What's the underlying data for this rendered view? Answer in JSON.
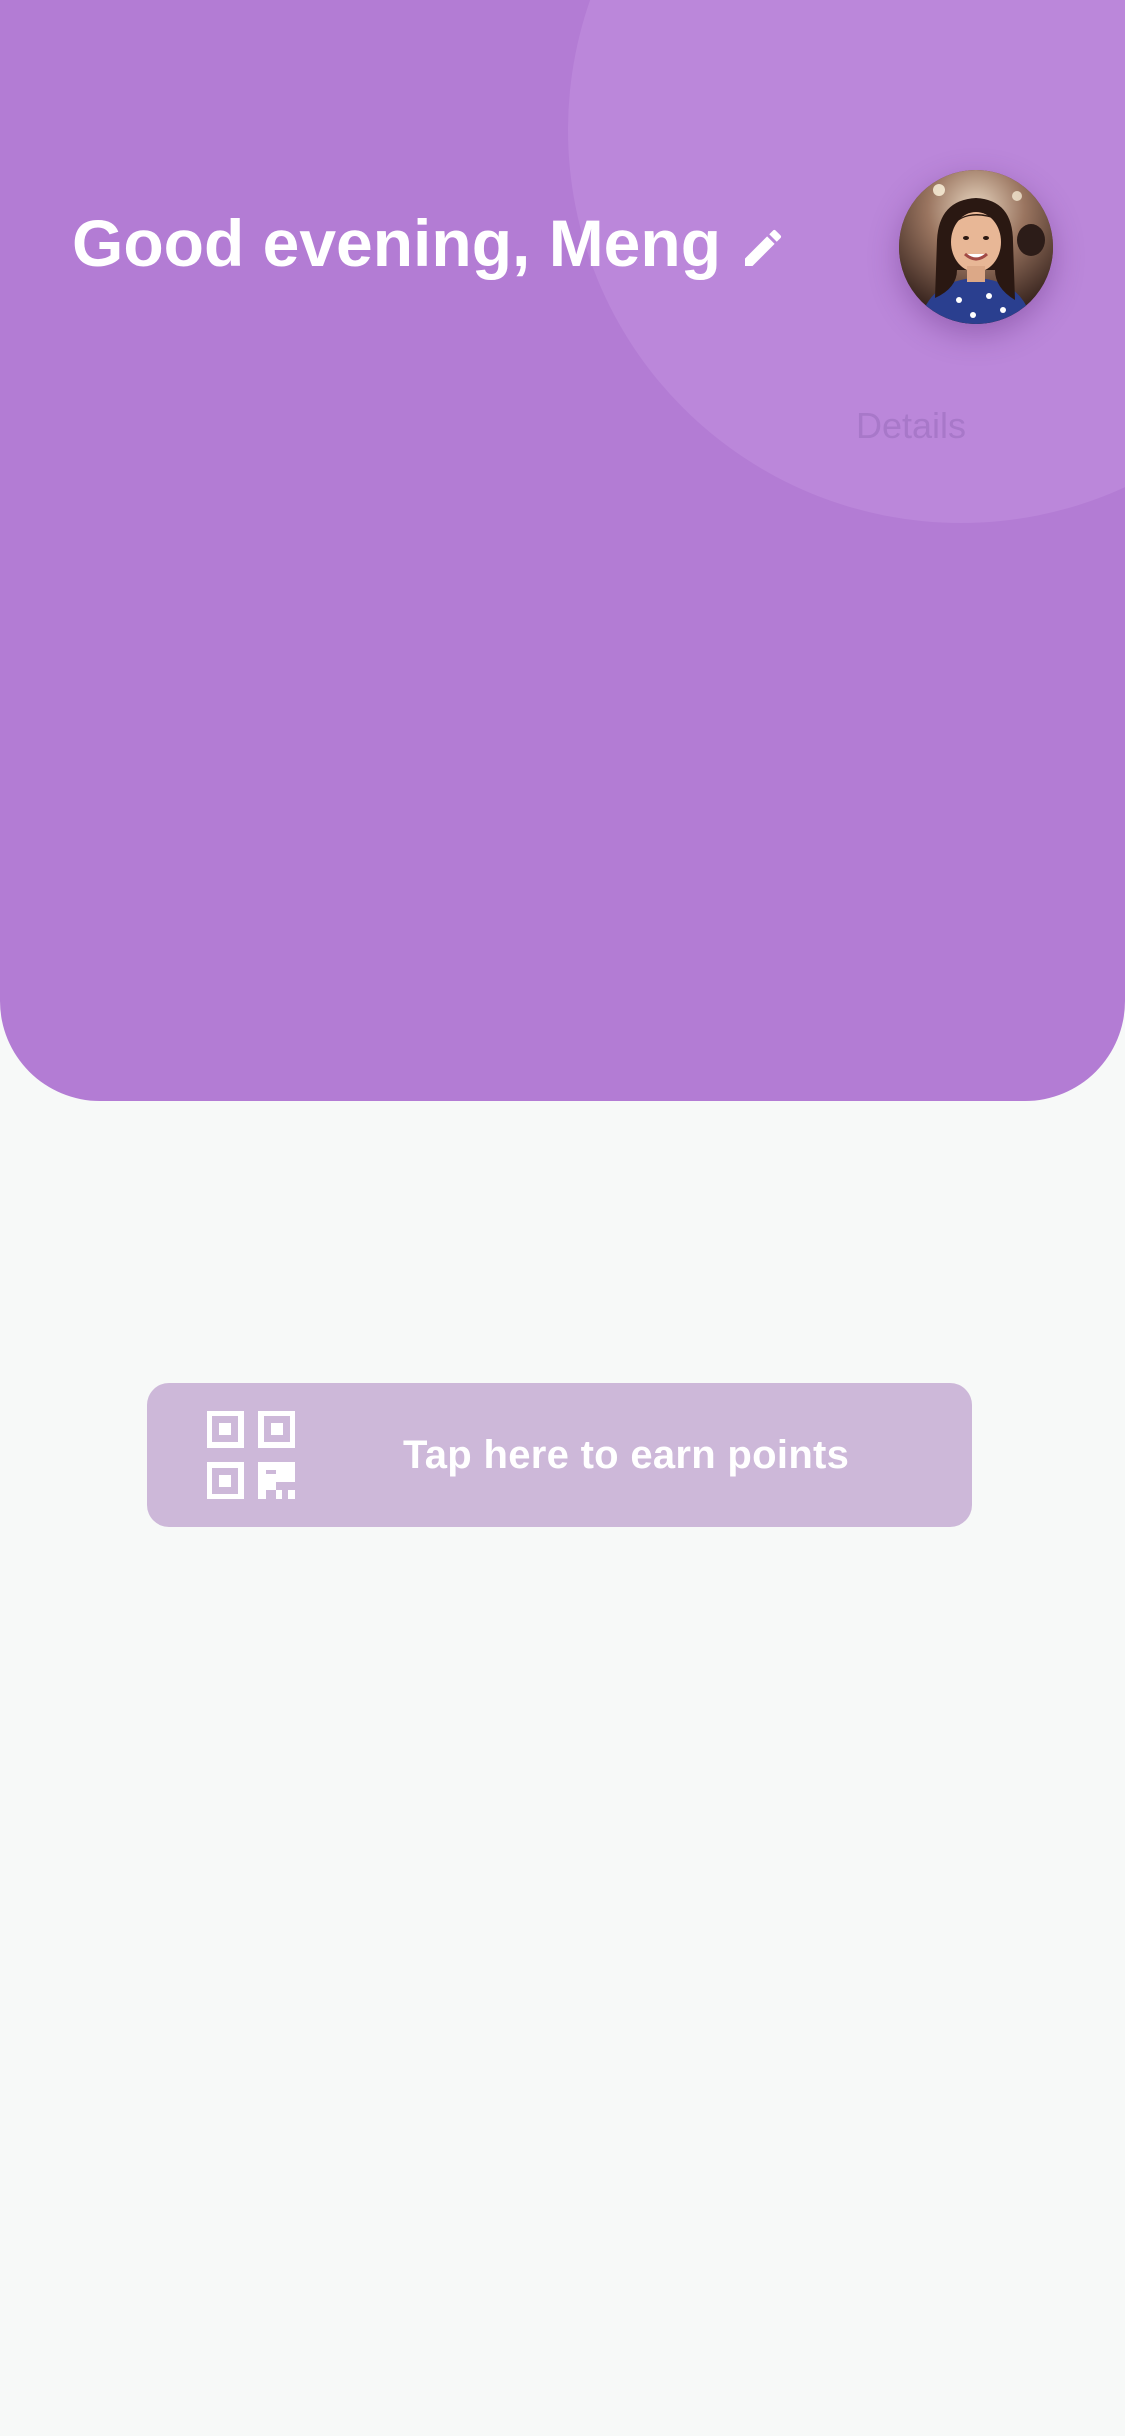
{
  "header": {
    "greeting": "Good evening, Meng",
    "edit_icon": "pencil-icon",
    "details_label": "Details",
    "avatar_alt": "profile-photo",
    "background_color": "#b37cd4",
    "decor_color": "#bb87da"
  },
  "earn_points": {
    "label": "Tap here to earn points",
    "icon": "qr-code-icon",
    "background_color": "#cdb8d9"
  }
}
